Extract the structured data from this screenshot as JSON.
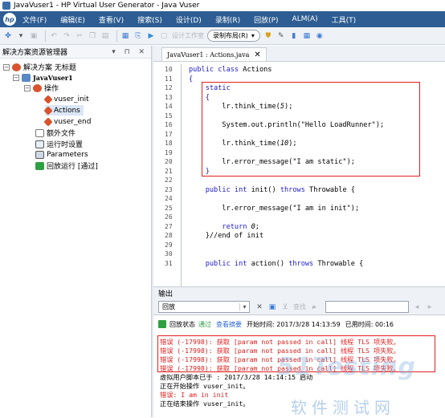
{
  "window": {
    "title": "JavaVuser1 - HP Virtual User Generator - Java Vuser"
  },
  "menu": [
    "文件(F)",
    "编辑(E)",
    "查看(V)",
    "搜索(S)",
    "设计(D)",
    "录制(R)",
    "回放(P)",
    "ALM(A)",
    "工具(T)"
  ],
  "toolbar": {
    "design_label": "设计工作室",
    "layout_label": "录制布局(R)"
  },
  "solution_explorer": {
    "title": "解决方案资源管理器",
    "pin": "▾ ⊓ ✕",
    "root": "解决方案 无标题",
    "script": "JavaVuser1",
    "actions_label": "操作",
    "actions": [
      "vuser_init",
      "Actions",
      "vuser_end"
    ],
    "extra_files": "额外文件",
    "runtime_settings": "运行时设置",
    "parameters": "Parameters",
    "replay_run": "回放运行 [通过]"
  },
  "editor": {
    "tab": "JavaVuser1 : Actions.java",
    "lines": [
      {
        "n": "10",
        "segs": [
          {
            "t": "public class ",
            "c": "kw"
          },
          {
            "t": "Actions",
            "c": ""
          }
        ]
      },
      {
        "n": "11",
        "segs": [
          {
            "t": "{",
            "c": "kw"
          }
        ]
      },
      {
        "n": "12",
        "segs": [
          {
            "t": "    static",
            "c": "kw"
          }
        ]
      },
      {
        "n": "13",
        "segs": [
          {
            "t": "    {",
            "c": "kw"
          }
        ]
      },
      {
        "n": "14",
        "segs": [
          {
            "t": "        lr.think_time(",
            "c": ""
          },
          {
            "t": "5",
            "c": "it"
          },
          {
            "t": ");",
            "c": ""
          }
        ]
      },
      {
        "n": "15",
        "segs": []
      },
      {
        "n": "16",
        "segs": [
          {
            "t": "        System.out.println(\"Hello LoadRunner\");",
            "c": ""
          }
        ]
      },
      {
        "n": "17",
        "segs": []
      },
      {
        "n": "18",
        "segs": [
          {
            "t": "        lr.think_time(",
            "c": ""
          },
          {
            "t": "10",
            "c": "it"
          },
          {
            "t": ");",
            "c": ""
          }
        ]
      },
      {
        "n": "19",
        "segs": []
      },
      {
        "n": "20",
        "segs": [
          {
            "t": "        lr.error_message(\"I am static\");",
            "c": ""
          }
        ]
      },
      {
        "n": "21",
        "segs": [
          {
            "t": "    }",
            "c": "kw"
          }
        ]
      },
      {
        "n": "22",
        "segs": []
      },
      {
        "n": "23",
        "segs": [
          {
            "t": "    public int ",
            "c": "kw"
          },
          {
            "t": "init() ",
            "c": ""
          },
          {
            "t": "throws ",
            "c": "kw"
          },
          {
            "t": "Throwable {",
            "c": ""
          }
        ]
      },
      {
        "n": "24",
        "segs": []
      },
      {
        "n": "25",
        "segs": [
          {
            "t": "        lr.error_message(\"I am in init\");",
            "c": ""
          }
        ]
      },
      {
        "n": "26",
        "segs": []
      },
      {
        "n": "27",
        "segs": [
          {
            "t": "        return ",
            "c": "kw"
          },
          {
            "t": "0",
            "c": "it"
          },
          {
            "t": ";",
            "c": ""
          }
        ]
      },
      {
        "n": "28",
        "segs": [
          {
            "t": "    }//end of init",
            "c": ""
          }
        ]
      },
      {
        "n": "29",
        "segs": []
      },
      {
        "n": "30",
        "segs": []
      },
      {
        "n": "31",
        "segs": [
          {
            "t": "    public int ",
            "c": "kw"
          },
          {
            "t": "action() ",
            "c": ""
          },
          {
            "t": "throws ",
            "c": "kw"
          },
          {
            "t": "Throwable {",
            "c": ""
          }
        ]
      }
    ]
  },
  "output": {
    "title": "输出",
    "filter": "回放",
    "find_label": "查找",
    "status_prefix": "回放状态",
    "status_value": "通过",
    "summary_link": "查看摘要",
    "start_time": "开始时间: 2017/3/28 14:13:59",
    "elapsed": "已用时间: 00:16",
    "log": [
      {
        "t": "错误 (-17998): 获取 [param not passed in call] 线程 TLS 项失败。",
        "e": true
      },
      {
        "t": "错误 (-17998): 获取 [param not passed in call] 线程 TLS 项失败。",
        "e": true
      },
      {
        "t": "错误 (-17998): 获取 [param not passed in call] 线程 TLS 项失败。",
        "e": true
      },
      {
        "t": "错误 (-17998): 获取 [param not passed in call] 线程 TLS 项失败。",
        "e": true
      },
      {
        "t": "虚拟用户脚本已于 : 2017/3/28 14:14:15 启动",
        "e": false
      },
      {
        "t": "正在开始操作 vuser_init。",
        "e": false
      },
      {
        "t": "错误: I am in init",
        "e": true
      },
      {
        "t": "正在结束操作 vuser_init。",
        "e": false
      }
    ]
  },
  "watermark": {
    "text": "51Testing",
    "cn": "软件测试网"
  },
  "colors": {
    "menubar": "#2d5d92",
    "error": "#e0201f",
    "keyword": "#1d1ad1",
    "link": "#2f6bd7"
  }
}
